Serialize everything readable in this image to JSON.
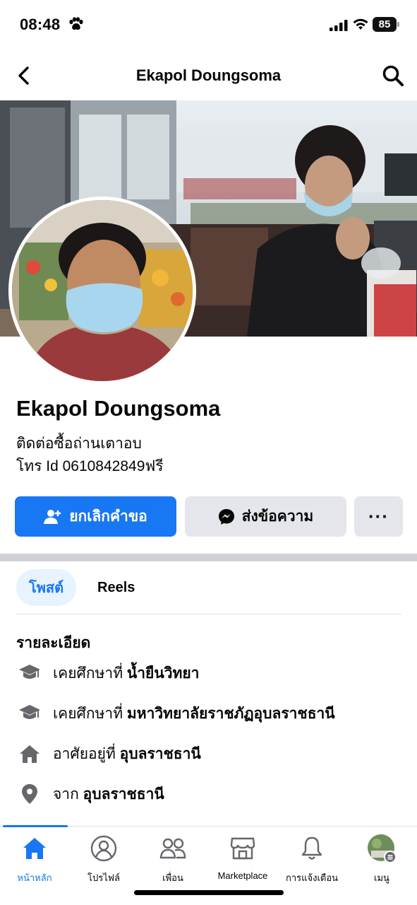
{
  "status_bar": {
    "time": "08:48",
    "battery": "85"
  },
  "header": {
    "title": "Ekapol Doungsoma"
  },
  "profile": {
    "name": "Ekapol Doungsoma",
    "bio_line1": "ติดต่อซื้อถ่านเตาอบ",
    "bio_line2": "โทร  Id 0610842849ฟรี"
  },
  "actions": {
    "primary_label": "ยกเลิกคำขอ",
    "message_label": "ส่งข้อความ",
    "more_label": "···"
  },
  "tabs": [
    {
      "label": "โพสต์",
      "active": true
    },
    {
      "label": "Reels",
      "active": false
    }
  ],
  "details": {
    "title": "รายละเอียด",
    "items": [
      {
        "icon": "graduation-cap-icon",
        "prefix": "เคยศึกษาที่",
        "value": "น้ำยืนวิทยา"
      },
      {
        "icon": "graduation-cap-icon",
        "prefix": "เคยศึกษาที่",
        "value": "มหาวิทยาลัยราชภัฏอุบลราชธานี"
      },
      {
        "icon": "home-icon",
        "prefix": "อาศัยอยู่ที่",
        "value": "อุบลราชธานี"
      },
      {
        "icon": "location-pin-icon",
        "prefix": "จาก",
        "value": "อุบลราชธานี"
      }
    ]
  },
  "bottom_nav": [
    {
      "label": "หน้าหลัก",
      "icon": "home-icon",
      "active": true
    },
    {
      "label": "โปรไฟล์",
      "icon": "profile-icon",
      "active": false
    },
    {
      "label": "เพื่อน",
      "icon": "friends-icon",
      "active": false
    },
    {
      "label": "Marketplace",
      "icon": "marketplace-icon",
      "active": false
    },
    {
      "label": "การแจ้งเตือน",
      "icon": "bell-icon",
      "active": false
    },
    {
      "label": "เมนู",
      "icon": "menu-avatar-icon",
      "active": false
    }
  ],
  "colors": {
    "accent": "#1877f2",
    "secondary_button": "#e4e6eb",
    "active_tab_bg": "#e7f3ff"
  }
}
